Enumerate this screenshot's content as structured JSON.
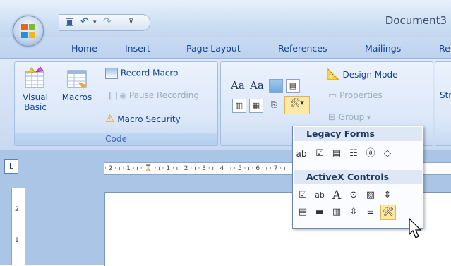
{
  "window": {
    "title": "Document3"
  },
  "tabs": [
    "Home",
    "Insert",
    "Page Layout",
    "References",
    "Mailings",
    "Re"
  ],
  "ribbon": {
    "code": {
      "label": "Code",
      "visual_basic_1": "Visual",
      "visual_basic_2": "Basic",
      "macros": "Macros",
      "record_macro": "Record Macro",
      "pause_recording": "Pause Recording",
      "macro_security": "Macro Security"
    },
    "controls": {
      "design_mode": "Design Mode",
      "properties": "Properties",
      "group": "Group"
    },
    "next_group_partial": "Str"
  },
  "ruler": {
    "corner": "L",
    "marks": "· 2 · ı · 1 · ı · ⌛ · ı · 1 · ı · 2 · ı · 3 · ı · 4 · ı · 5 · ı · 6 · ı · 7 · ı",
    "vertical_marks": [
      "2",
      "1"
    ]
  },
  "dropdown": {
    "legacy_forms": "Legacy Forms",
    "activex_controls": "ActiveX Controls"
  },
  "colors": {
    "ribbon_bg": "#dfeafa",
    "accent": "#15428b",
    "highlight": "#fce9a6"
  }
}
